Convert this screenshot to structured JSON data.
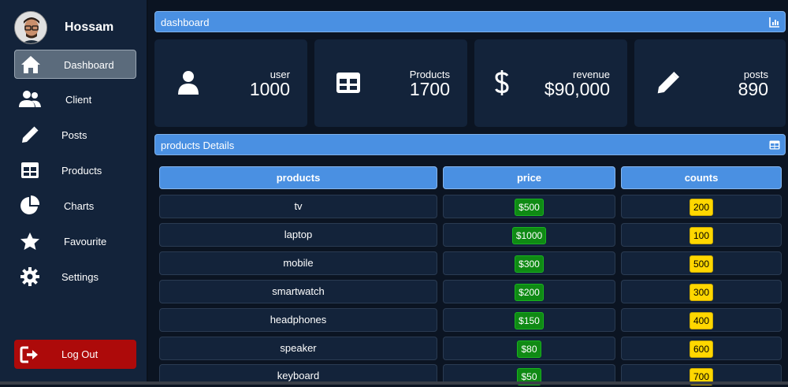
{
  "profile": {
    "name": "Hossam"
  },
  "sidebar": {
    "items": [
      {
        "label": "Dashboard",
        "icon": "home-icon",
        "active": true
      },
      {
        "label": "Client",
        "icon": "users-icon"
      },
      {
        "label": "Posts",
        "icon": "pencil-icon"
      },
      {
        "label": "Products",
        "icon": "table-icon"
      },
      {
        "label": "Charts",
        "icon": "pie-chart-icon"
      },
      {
        "label": "Favourite",
        "icon": "star-icon"
      },
      {
        "label": "Settings",
        "icon": "gear-icon"
      }
    ],
    "logout": {
      "label": "Log Out",
      "icon": "sign-out-icon"
    }
  },
  "dashboard_bar": {
    "title": "dashboard",
    "icon": "chart-icon"
  },
  "cards": [
    {
      "label": "user",
      "value": "1000",
      "icon": "user-icon"
    },
    {
      "label": "Products",
      "value": "1700",
      "icon": "table-icon"
    },
    {
      "label": "revenue",
      "value": "$90,000",
      "icon": "dollar-icon"
    },
    {
      "label": "posts",
      "value": "890",
      "icon": "pencil-icon"
    }
  ],
  "details_bar": {
    "title": "products Details",
    "icon": "table-icon"
  },
  "table": {
    "headers": [
      "products",
      "price",
      "counts"
    ],
    "rows": [
      {
        "product": "tv",
        "price": "$500",
        "count": "200"
      },
      {
        "product": "laptop",
        "price": "$1000",
        "count": "100"
      },
      {
        "product": "mobile",
        "price": "$300",
        "count": "500"
      },
      {
        "product": "smartwatch",
        "price": "$200",
        "count": "300"
      },
      {
        "product": "headphones",
        "price": "$150",
        "count": "400"
      },
      {
        "product": "speaker",
        "price": "$80",
        "count": "600"
      },
      {
        "product": "keyboard",
        "price": "$50",
        "count": "700"
      }
    ]
  },
  "colors": {
    "background": "#0b1422",
    "panel": "#13233a",
    "accent": "#4a90e2",
    "logout": "#ad0a0a",
    "price_badge": "#0f8a14",
    "count_badge": "#ffd700"
  }
}
